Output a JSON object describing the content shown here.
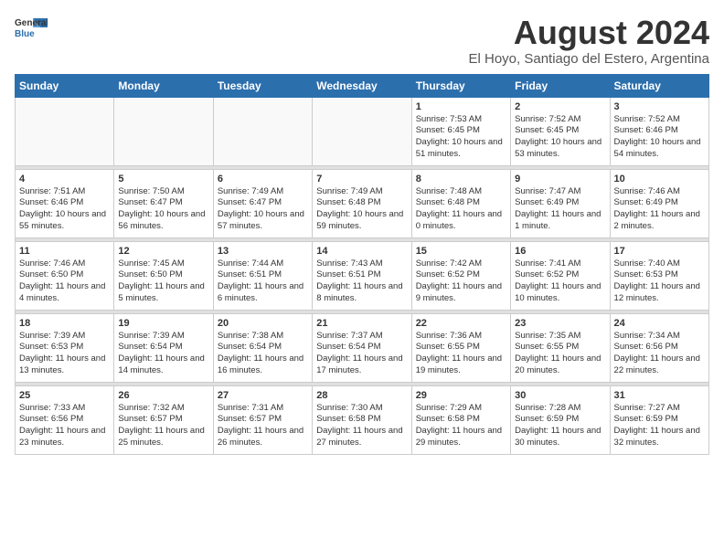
{
  "header": {
    "logo_general": "General",
    "logo_blue": "Blue",
    "month_year": "August 2024",
    "location": "El Hoyo, Santiago del Estero, Argentina"
  },
  "calendar": {
    "days_of_week": [
      "Sunday",
      "Monday",
      "Tuesday",
      "Wednesday",
      "Thursday",
      "Friday",
      "Saturday"
    ],
    "weeks": [
      [
        {
          "day": "",
          "content": ""
        },
        {
          "day": "",
          "content": ""
        },
        {
          "day": "",
          "content": ""
        },
        {
          "day": "",
          "content": ""
        },
        {
          "day": "1",
          "content": "Sunrise: 7:53 AM\nSunset: 6:45 PM\nDaylight: 10 hours\nand 51 minutes."
        },
        {
          "day": "2",
          "content": "Sunrise: 7:52 AM\nSunset: 6:45 PM\nDaylight: 10 hours\nand 53 minutes."
        },
        {
          "day": "3",
          "content": "Sunrise: 7:52 AM\nSunset: 6:46 PM\nDaylight: 10 hours\nand 54 minutes."
        }
      ],
      [
        {
          "day": "4",
          "content": "Sunrise: 7:51 AM\nSunset: 6:46 PM\nDaylight: 10 hours\nand 55 minutes."
        },
        {
          "day": "5",
          "content": "Sunrise: 7:50 AM\nSunset: 6:47 PM\nDaylight: 10 hours\nand 56 minutes."
        },
        {
          "day": "6",
          "content": "Sunrise: 7:49 AM\nSunset: 6:47 PM\nDaylight: 10 hours\nand 57 minutes."
        },
        {
          "day": "7",
          "content": "Sunrise: 7:49 AM\nSunset: 6:48 PM\nDaylight: 10 hours\nand 59 minutes."
        },
        {
          "day": "8",
          "content": "Sunrise: 7:48 AM\nSunset: 6:48 PM\nDaylight: 11 hours\nand 0 minutes."
        },
        {
          "day": "9",
          "content": "Sunrise: 7:47 AM\nSunset: 6:49 PM\nDaylight: 11 hours\nand 1 minute."
        },
        {
          "day": "10",
          "content": "Sunrise: 7:46 AM\nSunset: 6:49 PM\nDaylight: 11 hours\nand 2 minutes."
        }
      ],
      [
        {
          "day": "11",
          "content": "Sunrise: 7:46 AM\nSunset: 6:50 PM\nDaylight: 11 hours\nand 4 minutes."
        },
        {
          "day": "12",
          "content": "Sunrise: 7:45 AM\nSunset: 6:50 PM\nDaylight: 11 hours\nand 5 minutes."
        },
        {
          "day": "13",
          "content": "Sunrise: 7:44 AM\nSunset: 6:51 PM\nDaylight: 11 hours\nand 6 minutes."
        },
        {
          "day": "14",
          "content": "Sunrise: 7:43 AM\nSunset: 6:51 PM\nDaylight: 11 hours\nand 8 minutes."
        },
        {
          "day": "15",
          "content": "Sunrise: 7:42 AM\nSunset: 6:52 PM\nDaylight: 11 hours\nand 9 minutes."
        },
        {
          "day": "16",
          "content": "Sunrise: 7:41 AM\nSunset: 6:52 PM\nDaylight: 11 hours\nand 10 minutes."
        },
        {
          "day": "17",
          "content": "Sunrise: 7:40 AM\nSunset: 6:53 PM\nDaylight: 11 hours\nand 12 minutes."
        }
      ],
      [
        {
          "day": "18",
          "content": "Sunrise: 7:39 AM\nSunset: 6:53 PM\nDaylight: 11 hours\nand 13 minutes."
        },
        {
          "day": "19",
          "content": "Sunrise: 7:39 AM\nSunset: 6:54 PM\nDaylight: 11 hours\nand 14 minutes."
        },
        {
          "day": "20",
          "content": "Sunrise: 7:38 AM\nSunset: 6:54 PM\nDaylight: 11 hours\nand 16 minutes."
        },
        {
          "day": "21",
          "content": "Sunrise: 7:37 AM\nSunset: 6:54 PM\nDaylight: 11 hours\nand 17 minutes."
        },
        {
          "day": "22",
          "content": "Sunrise: 7:36 AM\nSunset: 6:55 PM\nDaylight: 11 hours\nand 19 minutes."
        },
        {
          "day": "23",
          "content": "Sunrise: 7:35 AM\nSunset: 6:55 PM\nDaylight: 11 hours\nand 20 minutes."
        },
        {
          "day": "24",
          "content": "Sunrise: 7:34 AM\nSunset: 6:56 PM\nDaylight: 11 hours\nand 22 minutes."
        }
      ],
      [
        {
          "day": "25",
          "content": "Sunrise: 7:33 AM\nSunset: 6:56 PM\nDaylight: 11 hours\nand 23 minutes."
        },
        {
          "day": "26",
          "content": "Sunrise: 7:32 AM\nSunset: 6:57 PM\nDaylight: 11 hours\nand 25 minutes."
        },
        {
          "day": "27",
          "content": "Sunrise: 7:31 AM\nSunset: 6:57 PM\nDaylight: 11 hours\nand 26 minutes."
        },
        {
          "day": "28",
          "content": "Sunrise: 7:30 AM\nSunset: 6:58 PM\nDaylight: 11 hours\nand 27 minutes."
        },
        {
          "day": "29",
          "content": "Sunrise: 7:29 AM\nSunset: 6:58 PM\nDaylight: 11 hours\nand 29 minutes."
        },
        {
          "day": "30",
          "content": "Sunrise: 7:28 AM\nSunset: 6:59 PM\nDaylight: 11 hours\nand 30 minutes."
        },
        {
          "day": "31",
          "content": "Sunrise: 7:27 AM\nSunset: 6:59 PM\nDaylight: 11 hours\nand 32 minutes."
        }
      ]
    ]
  }
}
